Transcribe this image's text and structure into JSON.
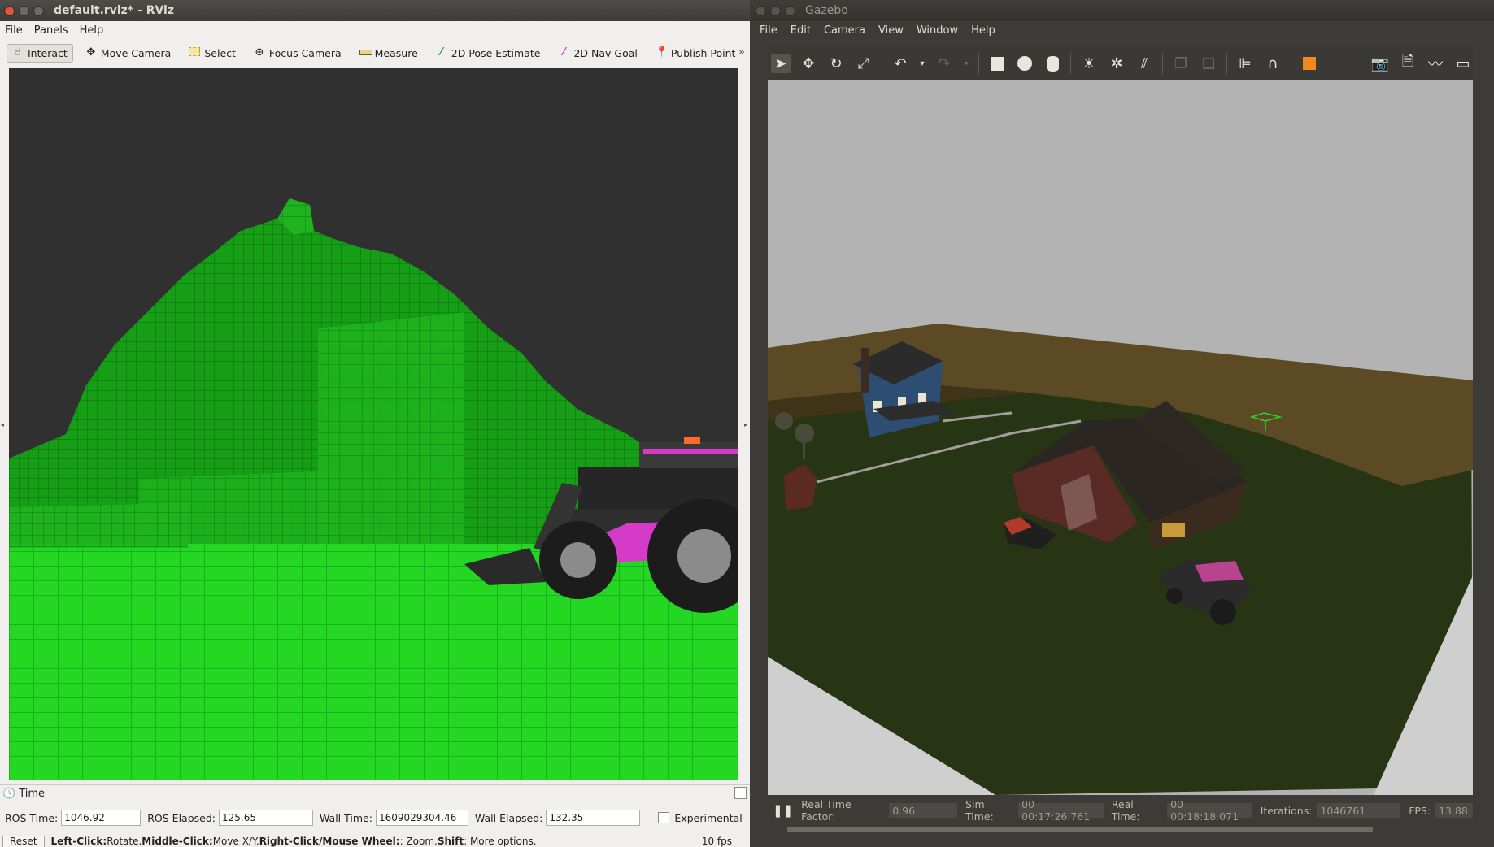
{
  "rviz": {
    "title": "default.rviz* - RViz",
    "menu": [
      "File",
      "Panels",
      "Help"
    ],
    "toolbar": {
      "tools": [
        {
          "label": "Interact",
          "icon": "hand-cursor-icon"
        },
        {
          "label": "Move Camera",
          "icon": "move-camera-icon"
        },
        {
          "label": "Select",
          "icon": "select-rect-icon"
        },
        {
          "label": "Focus Camera",
          "icon": "focus-camera-icon"
        },
        {
          "label": "Measure",
          "icon": "ruler-icon"
        },
        {
          "label": "2D Pose Estimate",
          "icon": "green-arrow-icon"
        },
        {
          "label": "2D Nav Goal",
          "icon": "pink-arrow-icon"
        },
        {
          "label": "Publish Point",
          "icon": "map-pin-icon"
        }
      ],
      "more": "»"
    },
    "time_panel": {
      "title": "Time",
      "ros_time_label": "ROS Time:",
      "ros_time": "1046.92",
      "ros_elapsed_label": "ROS Elapsed:",
      "ros_elapsed": "125.65",
      "wall_time_label": "Wall Time:",
      "wall_time": "1609029304.46",
      "wall_elapsed_label": "Wall Elapsed:",
      "wall_elapsed": "132.35",
      "experimental_label": "Experimental"
    },
    "status": {
      "reset": "Reset",
      "help_left": "Left-Click:",
      "help_left_action": " Rotate. ",
      "help_middle": "Middle-Click:",
      "help_middle_action": " Move X/Y. ",
      "help_right": "Right-Click/Mouse Wheel:",
      "help_right_action": ": Zoom. ",
      "help_shift": "Shift",
      "help_shift_action": ": More options.",
      "fps": "10 fps"
    },
    "colors": {
      "voxel": "#1aa31a",
      "ground": "#22d622",
      "background": "#303030",
      "accent": "#d43cc8"
    }
  },
  "gazebo": {
    "title": "Gazebo",
    "menu": [
      "File",
      "Edit",
      "Camera",
      "View",
      "Window",
      "Help"
    ],
    "bottom": {
      "pause_icon": "pause-icon",
      "rtf_label": "Real Time Factor:",
      "rtf": "0.96",
      "sim_time_label": "Sim Time:",
      "sim_time": "00 00:17:26.761",
      "real_time_label": "Real Time:",
      "real_time": "00 00:18:18.071",
      "iterations_label": "Iterations:",
      "iterations": "1046761",
      "fps_label": "FPS:",
      "fps": "13.88"
    },
    "colors": {
      "ground": "#283514",
      "sky": "#b4b4b4",
      "crop": "#5b4a24"
    }
  }
}
